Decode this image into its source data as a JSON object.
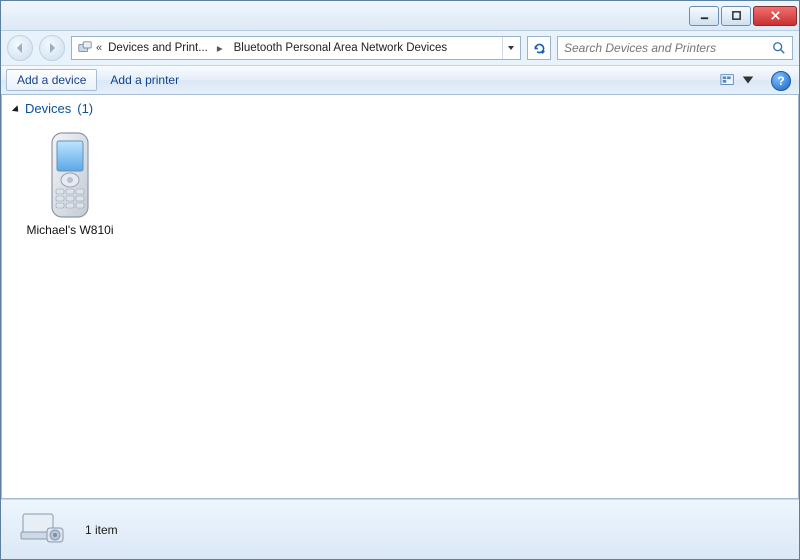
{
  "breadcrumb": {
    "prefix_indicator": "«",
    "segment1": "Devices and Print...",
    "segment2": "Bluetooth Personal Area Network Devices"
  },
  "search": {
    "placeholder": "Search Devices and Printers"
  },
  "toolbar": {
    "add_device": "Add a device",
    "add_printer": "Add a printer"
  },
  "section": {
    "title": "Devices",
    "count": "(1)"
  },
  "devices": [
    {
      "label": "Michael's W810i"
    }
  ],
  "status": {
    "text": "1 item"
  }
}
